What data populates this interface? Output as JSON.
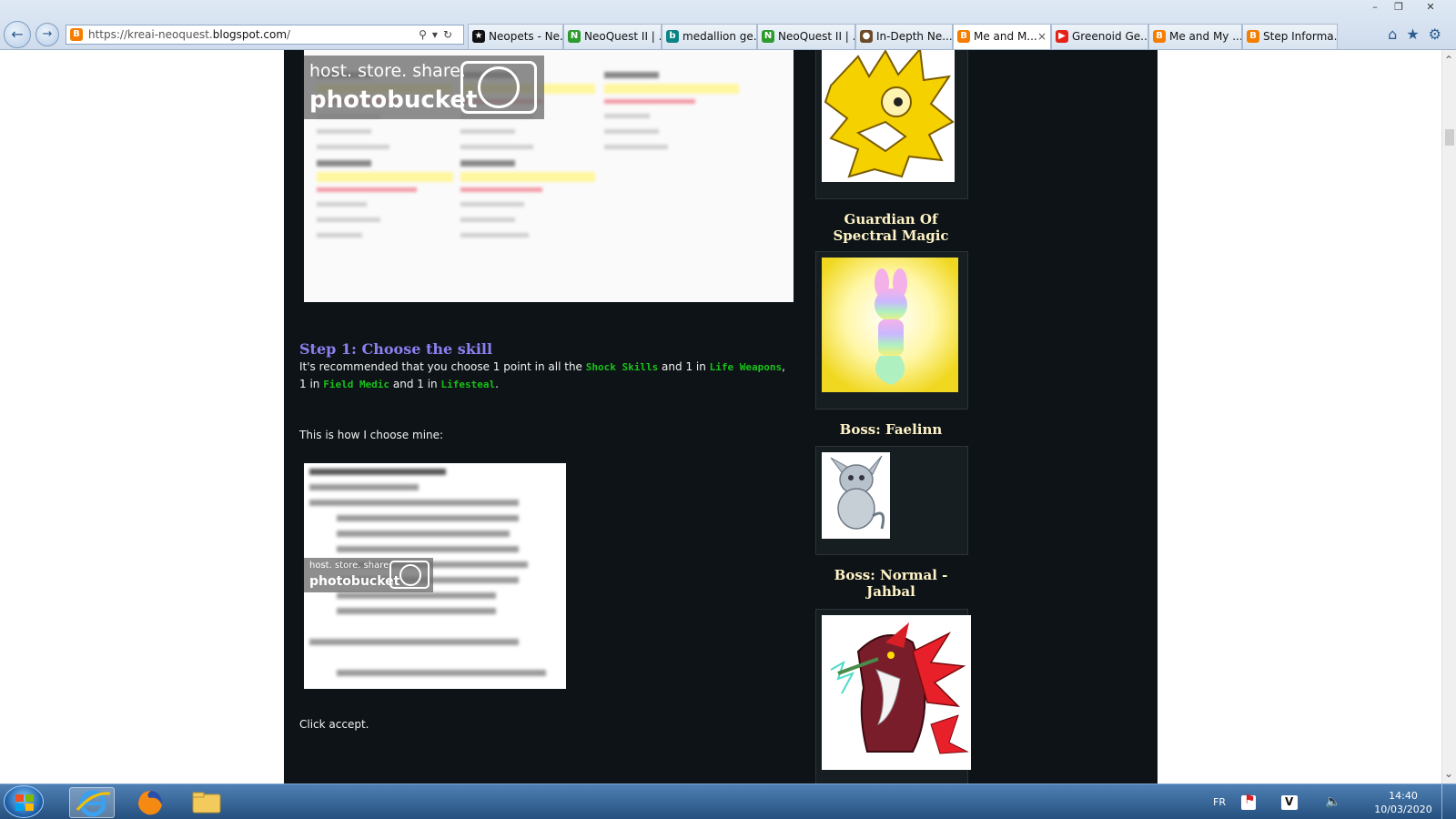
{
  "browser": {
    "url_prefix": "https://kreai-neoquest.",
    "url_domain": "blogspot.com",
    "url_suffix": "/",
    "tabs": [
      {
        "label": "Neopets - Ne...",
        "icon": "star-icon",
        "color": "#111111"
      },
      {
        "label": "NeoQuest II | ...",
        "icon": "neopets-icon",
        "color": "#2e9b2e"
      },
      {
        "label": "medallion ge...",
        "icon": "bing-icon",
        "color": "#0c8484"
      },
      {
        "label": "NeoQuest II | ...",
        "icon": "neopets-icon",
        "color": "#2e9b2e"
      },
      {
        "label": "In-Depth Ne...",
        "icon": "site-icon",
        "color": "#6b4a2a"
      },
      {
        "label": "Me and M...",
        "icon": "blogger-icon",
        "color": "#f57d00",
        "active": true
      },
      {
        "label": "Greenoid Ge...",
        "icon": "youtube-icon",
        "color": "#e62117"
      },
      {
        "label": "Me and My ...",
        "icon": "blogger-icon",
        "color": "#f57d00"
      },
      {
        "label": "Step Informa...",
        "icon": "blogger-icon",
        "color": "#f57d00"
      }
    ],
    "tab_close": "×"
  },
  "watermark": {
    "line1": "host. store. share.",
    "line2": "photobucket"
  },
  "post": {
    "step_title": "Step 1: Choose the skill",
    "intro_1": "It's recommended that you choose 1 point in all the ",
    "shock_skills": "Shock Skills",
    "and_1_in": " and 1 in ",
    "life_weapons": "Life Weapons",
    "comma_1_in": ", 1 in ",
    "field_medic": "Field Medic",
    "and_1_in_2": " and 1 in ",
    "lifesteal": "Lifesteal",
    "period": ".",
    "choose_mine": "This is how I choose mine:",
    "click_accept": "Click accept."
  },
  "sidebar": {
    "guardian_title": "Guardian Of Spectral Magic",
    "boss1_title": "Boss: Faelinn",
    "boss2_title": "Boss: Normal - Jahbal"
  },
  "taskbar": {
    "lang": "FR",
    "time": "14:40",
    "date": "10/03/2020"
  },
  "colors": {
    "blog_bg": "#0d1316",
    "step_title": "#8b80f0",
    "highlight": "#19c21a",
    "sidebar_title": "#fff3c7"
  }
}
